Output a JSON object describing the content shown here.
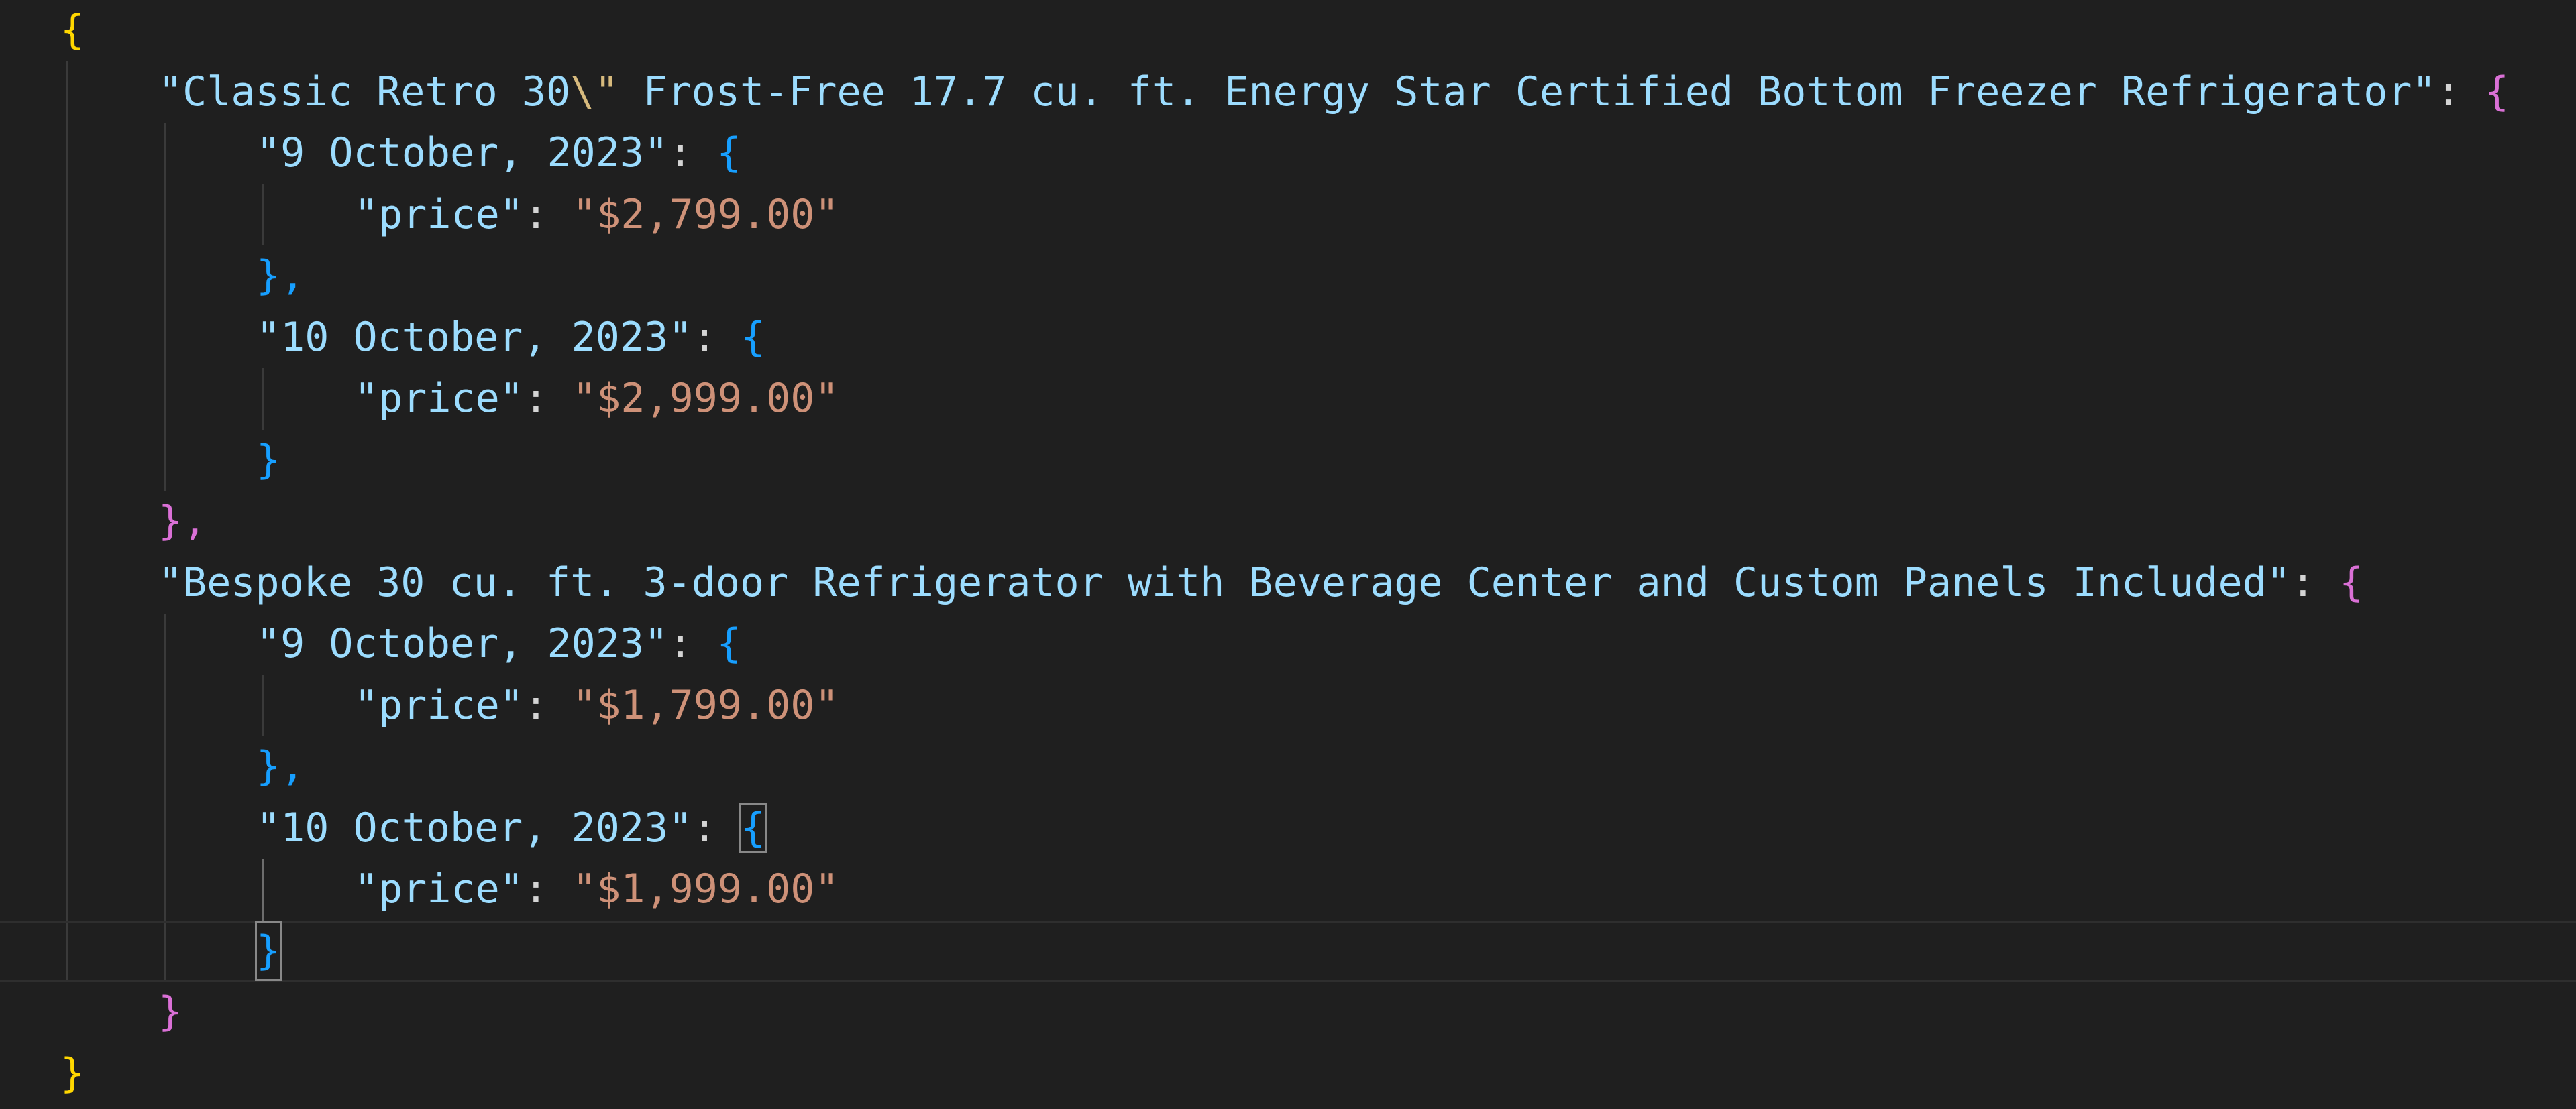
{
  "editor": {
    "language": "json",
    "brackets": {
      "level1": "{",
      "level1_close": "}",
      "level2": "{",
      "level2_close": "}",
      "level3": "{",
      "level3_close": "}"
    },
    "colors": {
      "background": "#1f1f1f",
      "key": "#9cdcfe",
      "string": "#ce9178",
      "bracket_level1": "#ffd700",
      "bracket_level2": "#da70d6",
      "bracket_level3": "#179fff"
    },
    "products": [
      {
        "name": "\"Classic Retro 30",
        "name_escape": "\\\"",
        "name_rest": " Frost-Free 17.7 cu. ft. Energy Star Certified Bottom Freezer Refrigerator\"",
        "dates": [
          {
            "date": "\"9 October, 2023\"",
            "price_key": "\"price\"",
            "price": "\"$2,799.00\"",
            "close": "},"
          },
          {
            "date": "\"10 October, 2023\"",
            "price_key": "\"price\"",
            "price": "\"$2,999.00\"",
            "close": "}"
          }
        ],
        "close": "},"
      },
      {
        "name": "\"Bespoke 30 cu. ft. 3-door Refrigerator with Beverage Center and Custom Panels Included\"",
        "dates": [
          {
            "date": "\"9 October, 2023\"",
            "price_key": "\"price\"",
            "price": "\"$1,799.00\"",
            "close": "},"
          },
          {
            "date": "\"10 October, 2023\"",
            "price_key": "\"price\"",
            "price": "\"$1,999.00\"",
            "close": "}"
          }
        ],
        "close": "}"
      }
    ]
  }
}
